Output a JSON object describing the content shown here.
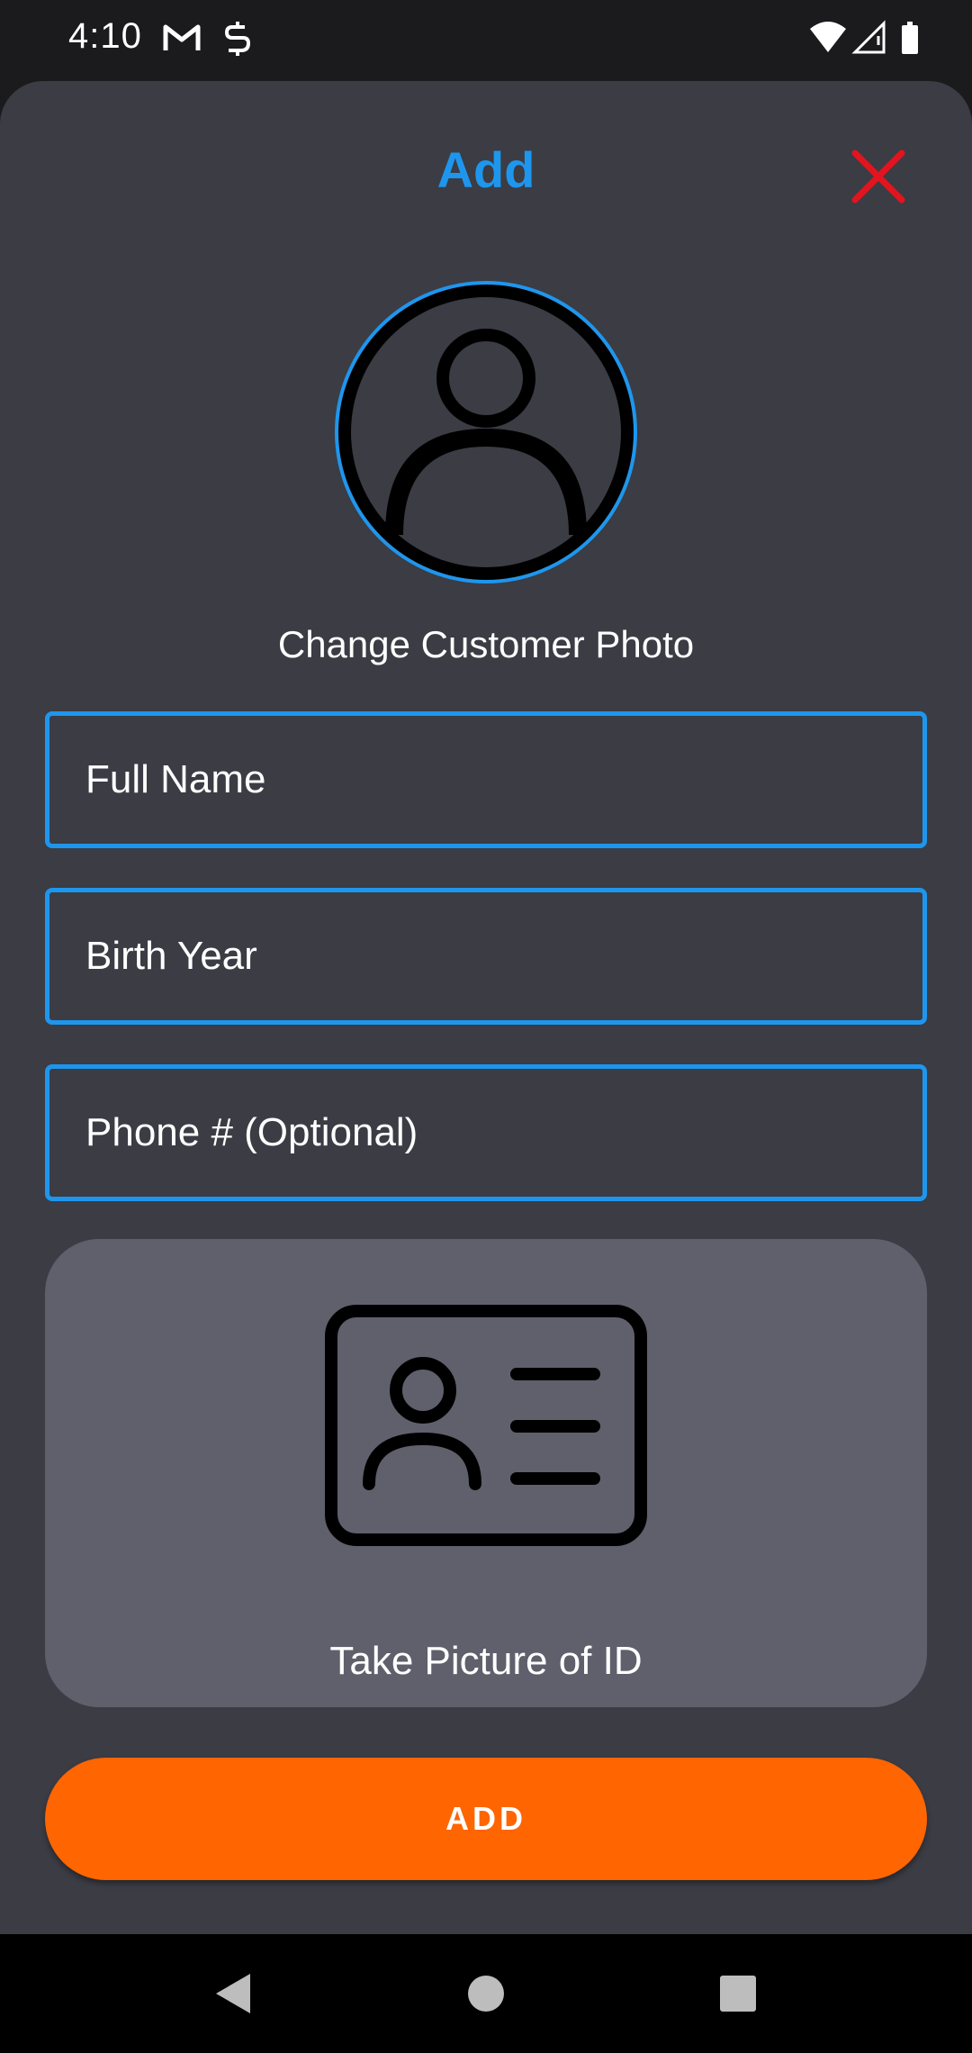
{
  "status_bar": {
    "time": "4:10",
    "left_icons": [
      "gmail-icon",
      "s-notification-icon"
    ],
    "right_icons": [
      "wifi-icon",
      "signal-icon",
      "battery-icon"
    ]
  },
  "dialog": {
    "title": "Add",
    "close_icon": "close-icon",
    "close_color": "#e2141f",
    "accent_color": "#1e96ee"
  },
  "photo": {
    "avatar_icon": "person-icon",
    "label": "Change Customer Photo"
  },
  "form": {
    "full_name_placeholder": "Full Name",
    "birth_year_placeholder": "Birth Year",
    "phone_placeholder": "Phone # (Optional)"
  },
  "id_capture": {
    "icon": "id-card-icon",
    "label": "Take Picture of ID"
  },
  "add_button": {
    "label": "ADD",
    "color": "#ff6500"
  },
  "nav_bar": {
    "buttons": [
      "back-icon",
      "home-icon",
      "recents-icon"
    ]
  }
}
